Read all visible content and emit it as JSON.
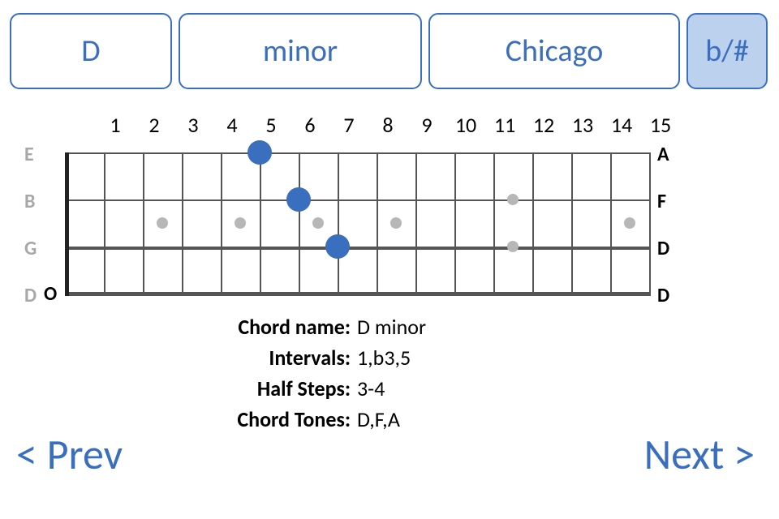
{
  "selectors": {
    "root": "D",
    "type": "minor",
    "style": "Chicago",
    "enharmonic": "b/#"
  },
  "fretboard": {
    "fret_numbers": [
      "1",
      "2",
      "3",
      "4",
      "5",
      "6",
      "7",
      "8",
      "9",
      "10",
      "11",
      "12",
      "13",
      "14",
      "15"
    ],
    "open_labels": [
      "E",
      "B",
      "G",
      "D"
    ],
    "right_labels": [
      "A",
      "F",
      "D",
      "D"
    ],
    "open_strings": [
      4
    ],
    "inlays_single_frets": [
      3,
      5,
      7,
      9,
      15
    ],
    "inlays_double_frets": [
      12
    ]
  },
  "chart_data": {
    "type": "table",
    "title": "Fretboard fingering",
    "strings": [
      "E",
      "B",
      "G",
      "D"
    ],
    "frets": 15,
    "fingerings": [
      {
        "string": "E",
        "fret": 5
      },
      {
        "string": "B",
        "fret": 6
      },
      {
        "string": "G",
        "fret": 7
      }
    ],
    "open": [
      {
        "string": "D"
      }
    ]
  },
  "info": {
    "chord_name_label": "Chord name:",
    "chord_name": "D minor",
    "intervals_label": "Intervals:",
    "intervals": "1,b3,5",
    "half_steps_label": "Half Steps:",
    "half_steps": "3-4",
    "chord_tones_label": "Chord Tones:",
    "chord_tones": "D,F,A"
  },
  "nav": {
    "prev": "<  Prev",
    "next": "Next  >"
  }
}
